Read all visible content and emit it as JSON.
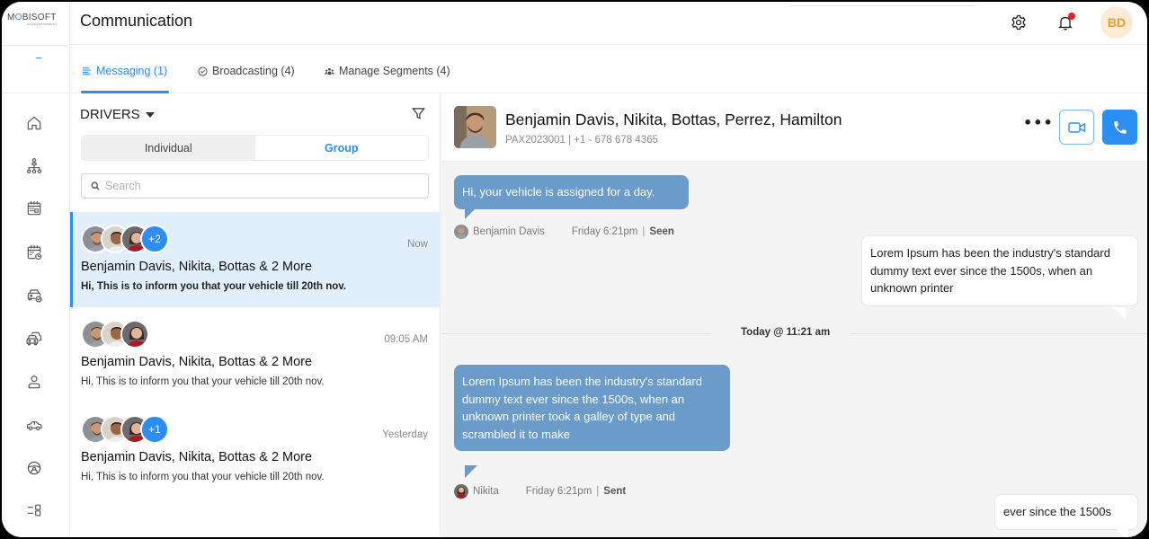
{
  "app": {
    "logo_text_prefix": "M",
    "logo_text_mark": "O",
    "logo_text_suffix": "BISOFT",
    "logo_tagline": "DISCOVER MOBILITY",
    "page_title": "Communication",
    "user_initials": "BD",
    "accent_color": "#2b8ef0"
  },
  "header_icons": {
    "settings": "gear-icon",
    "notifications": "bell-icon",
    "notification_badge": true
  },
  "sidebar": {
    "items": [
      {
        "name": "home",
        "icon": "home-icon"
      },
      {
        "name": "organization",
        "icon": "org-chart-icon"
      },
      {
        "name": "calendar",
        "icon": "calendar-icon"
      },
      {
        "name": "schedule",
        "icon": "calendar-clock-icon"
      },
      {
        "name": "vehicle-verified",
        "icon": "car-check-icon"
      },
      {
        "name": "fleet",
        "icon": "cars-icon"
      },
      {
        "name": "users",
        "icon": "user-icon"
      },
      {
        "name": "vehicles",
        "icon": "car-side-icon"
      },
      {
        "name": "drivers",
        "icon": "steering-wheel-icon"
      },
      {
        "name": "more",
        "icon": "list-grid-icon"
      }
    ]
  },
  "tabs": [
    {
      "label": "Messaging (1)",
      "icon": "messages-icon",
      "active": true
    },
    {
      "label": "Broadcasting (4)",
      "icon": "check-circle-icon",
      "active": false
    },
    {
      "label": "Manage Segments (4)",
      "icon": "group-icon",
      "active": false
    }
  ],
  "list": {
    "category_label": "DRIVERS",
    "segment": {
      "options": [
        "Individual",
        "Group"
      ],
      "selected": "Group"
    },
    "search_placeholder": "Search",
    "search_value": "",
    "conversations": [
      {
        "title": "Benjamin Davis, Nikita, Bottas & 2 More",
        "preview": "Hi, This is to inform you that your vehicle till 20th nov.",
        "time": "Now",
        "extra_count": "+2",
        "selected": true,
        "unread": true
      },
      {
        "title": "Benjamin Davis, Nikita, Bottas & 2 More",
        "preview": "Hi, This is to inform you that your vehicle till 20th nov.",
        "time": "09:05 AM",
        "extra_count": "",
        "selected": false,
        "unread": false
      },
      {
        "title": "Benjamin Davis, Nikita, Bottas & 2 More",
        "preview": "Hi, This is to inform you that your vehicle till 20th nov.",
        "time": "Yesterday",
        "extra_count": "+1",
        "selected": false,
        "unread": false
      }
    ]
  },
  "chat": {
    "title": "Benjamin Davis, Nikita, Bottas, Perrez, Hamilton",
    "id": "PAX2023001",
    "phone": "+1 -  678 678 4365",
    "subtitle": "PAX2023001 | +1 -  678 678 4365",
    "more_label": "•••",
    "divider_label": "Today @ 11:21 am",
    "messages": [
      {
        "direction": "incoming",
        "text": "Hi, your vehicle is assigned for a day.",
        "sender": "Benjamin Davis",
        "time": "Friday 6:21pm",
        "status": "Seen"
      },
      {
        "direction": "outgoing",
        "text": "Lorem Ipsum has been the industry's standard dummy text ever since the 1500s, when an unknown printer"
      },
      {
        "direction": "incoming",
        "text": "Lorem Ipsum has been the industry's standard dummy text ever since the 1500s, when an unknown printer took a galley of type and scrambled it to make",
        "sender": "Nikita",
        "time": "Friday 6:21pm",
        "status": "Sent"
      },
      {
        "direction": "outgoing",
        "text": "ever since the 1500s"
      }
    ]
  }
}
